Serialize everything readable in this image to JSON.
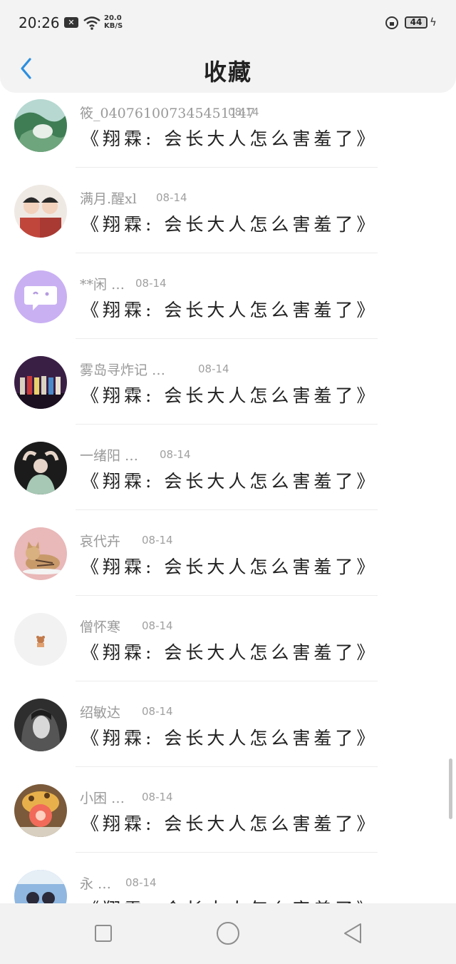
{
  "status_bar": {
    "time": "20:26",
    "net_speed_value": "20.0",
    "net_speed_unit": "KB/S",
    "battery": "44"
  },
  "header": {
    "title": "收藏",
    "back_icon": "chevron-left-icon",
    "accent_color": "#2b8fe0"
  },
  "items": [
    {
      "username": "筱_040761007345451147",
      "date": "08-14",
      "message": "《翔霖: 会长大人怎么害羞了》",
      "avatar": "landscape-photo",
      "avatar_color": "#3f7d55"
    },
    {
      "username": "满月.醒xl",
      "date": "08-14",
      "message": "《翔霖: 会长大人怎么害羞了》",
      "avatar": "two-people-photo",
      "avatar_color": "#c0463c"
    },
    {
      "username": "**闲 …",
      "date": "08-14",
      "message": "《翔霖: 会长大人怎么害羞了》",
      "avatar": "chat-bubble-icon",
      "avatar_color": "#c9b0f2"
    },
    {
      "username": "雾岛寻炸记 …",
      "date": "08-14",
      "message": "《翔霖: 会长大人怎么害羞了》",
      "avatar": "stage-group-photo",
      "avatar_color": "#6a3b6e"
    },
    {
      "username": "一绪阳 …",
      "date": "08-14",
      "message": "《翔霖: 会长大人怎么害羞了》",
      "avatar": "person-photo",
      "avatar_color": "#5a7a6a"
    },
    {
      "username": "哀代卉",
      "date": "08-14",
      "message": "《翔霖: 会长大人怎么害羞了》",
      "avatar": "cat-photo",
      "avatar_color": "#e9b8b8"
    },
    {
      "username": "僧怀寒",
      "date": "08-14",
      "message": "《翔霖: 会长大人怎么害羞了》",
      "avatar": "small-bear-icon",
      "avatar_color": "#f2f2f2"
    },
    {
      "username": "绍敏达",
      "date": "08-14",
      "message": "《翔霖: 会长大人怎么害羞了》",
      "avatar": "dark-portrait-photo",
      "avatar_color": "#444444"
    },
    {
      "username": "小困 …",
      "date": "08-14",
      "message": "《翔霖: 会长大人怎么害羞了》",
      "avatar": "plush-toy-photo",
      "avatar_color": "#e8b04a"
    },
    {
      "username": "永 …",
      "date": "08-14",
      "message": "《翔霖: 会长大人怎么害羞了》",
      "avatar": "poster-photo",
      "avatar_color": "#8fb7e0"
    }
  ],
  "nav_bar": {
    "recents_icon": "square-icon",
    "home_icon": "circle-icon",
    "back_icon": "triangle-back-icon"
  }
}
